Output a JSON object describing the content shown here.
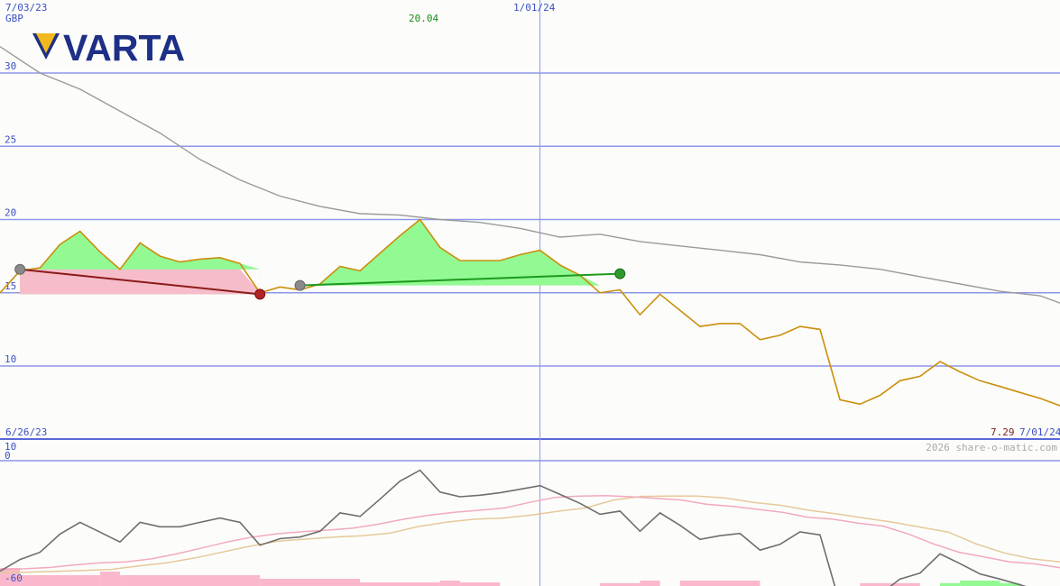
{
  "chart_data": [
    {
      "type": "line",
      "panel": "price",
      "currency": "GBP",
      "ylim": [
        5,
        33
      ],
      "y_ticks": [
        10,
        15,
        20,
        25,
        30
      ],
      "grid": true,
      "x_date_labels": {
        "start": "7/03/23",
        "mid": "1/01/24",
        "end": "7/01/24",
        "lower_start": "6/26/23"
      },
      "peak_label": "20.04",
      "last_value_label": "7.29",
      "watermark": "2026 share-o-matic.com",
      "series": [
        {
          "role": "price",
          "color": "#cc8e0c",
          "x": [
            "2023-06-26",
            "2023-07-03",
            "2023-07-10",
            "2023-07-17",
            "2023-07-24",
            "2023-07-31",
            "2023-08-07",
            "2023-08-14",
            "2023-08-21",
            "2023-08-28",
            "2023-09-04",
            "2023-09-11",
            "2023-09-18",
            "2023-09-25",
            "2023-10-02",
            "2023-10-09",
            "2023-10-16",
            "2023-10-23",
            "2023-10-30",
            "2023-11-06",
            "2023-11-13",
            "2023-11-20",
            "2023-11-27",
            "2023-12-04",
            "2023-12-11",
            "2023-12-18",
            "2023-12-25",
            "2024-01-01",
            "2024-01-08",
            "2024-01-15",
            "2024-01-22",
            "2024-01-29",
            "2024-02-05",
            "2024-02-12",
            "2024-02-19",
            "2024-02-26",
            "2024-03-04",
            "2024-03-11",
            "2024-03-18",
            "2024-03-25",
            "2024-04-01",
            "2024-04-08",
            "2024-04-15",
            "2024-04-22",
            "2024-04-29",
            "2024-05-06",
            "2024-05-13",
            "2024-05-20",
            "2024-05-27",
            "2024-06-03",
            "2024-06-10",
            "2024-06-17",
            "2024-06-24",
            "2024-07-01"
          ],
          "values": [
            15.0,
            16.5,
            16.7,
            18.3,
            19.2,
            17.8,
            16.6,
            18.4,
            17.5,
            17.1,
            17.3,
            17.4,
            17.0,
            15.0,
            15.4,
            15.2,
            15.6,
            16.8,
            16.5,
            17.7,
            18.9,
            20.0,
            18.1,
            17.2,
            17.2,
            17.2,
            17.6,
            17.9,
            16.9,
            16.2,
            15.0,
            15.2,
            13.5,
            14.9,
            13.8,
            12.7,
            12.9,
            12.9,
            11.8,
            12.1,
            12.7,
            12.5,
            7.7,
            7.4,
            8.0,
            9.0,
            9.3,
            10.3,
            9.6,
            9.0,
            8.6,
            8.2,
            7.8,
            7.29
          ]
        },
        {
          "role": "moving-average",
          "color": "#9a9a9a",
          "x": [
            "2023-06-26",
            "2023-07-10",
            "2023-07-24",
            "2023-08-07",
            "2023-08-21",
            "2023-09-04",
            "2023-09-18",
            "2023-10-02",
            "2023-10-16",
            "2023-10-30",
            "2023-11-13",
            "2023-11-27",
            "2023-12-11",
            "2023-12-25",
            "2024-01-08",
            "2024-01-22",
            "2024-02-05",
            "2024-02-19",
            "2024-03-04",
            "2024-03-18",
            "2024-04-01",
            "2024-04-15",
            "2024-04-29",
            "2024-05-13",
            "2024-05-27",
            "2024-06-10",
            "2024-06-24",
            "2024-07-01"
          ],
          "values": [
            31.8,
            30.0,
            28.9,
            27.4,
            25.9,
            24.1,
            22.7,
            21.6,
            20.9,
            20.4,
            20.3,
            20.0,
            19.8,
            19.4,
            18.8,
            19.0,
            18.5,
            18.2,
            17.9,
            17.6,
            17.1,
            16.9,
            16.6,
            16.1,
            15.6,
            15.1,
            14.8,
            14.3
          ]
        }
      ],
      "trades": [
        {
          "from": {
            "x": "2023-07-03",
            "y": 16.6
          },
          "to": {
            "x": "2023-09-25",
            "y": 14.9
          },
          "result": "loss",
          "color": "#8b1a1a"
        },
        {
          "from": {
            "x": "2023-10-09",
            "y": 15.5
          },
          "to": {
            "x": "2024-01-29",
            "y": 16.3
          },
          "result": "gain",
          "color": "#1e9a1e"
        }
      ]
    },
    {
      "type": "line",
      "panel": "indicator",
      "ylim": [
        -60,
        10
      ],
      "y_tick_labels": [
        "10",
        "0",
        "-60"
      ],
      "series": [
        {
          "role": "oscillator",
          "color": "#6e6e6e",
          "values": [
            -55.7,
            -49.8,
            -46.2,
            -37.0,
            -31.1,
            -36.0,
            -41.0,
            -31.1,
            -33.3,
            -33.3,
            -31.1,
            -28.9,
            -31.1,
            -42.6,
            -39.3,
            -38.5,
            -35.6,
            -26.3,
            -28.1,
            -19.4,
            -10.3,
            -4.8,
            -15.8,
            -18.2,
            -17.4,
            -16.2,
            -14.4,
            -12.6,
            -17.0,
            -21.5,
            -27.0,
            -25.4,
            -35.6,
            -26.3,
            -32.6,
            -39.7,
            -37.8,
            -36.7,
            -45.1,
            -42.2,
            -35.9,
            -37.4,
            -72.2,
            -73.3,
            -67.4,
            -59.7,
            -56.7,
            -47.0,
            -51.9,
            -57.1,
            -59.7,
            -62.6,
            -65.5,
            -70.0
          ]
        },
        {
          "role": "average-1",
          "color": "#f2a9c0",
          "values": [
            -55.0,
            -54.5,
            -53.8,
            -52.5,
            -51.5,
            -51.0,
            -49.5,
            -47.0,
            -44.0,
            -41.0,
            -38.5,
            -36.8,
            -35.8,
            -35.0,
            -34.0,
            -32.0,
            -29.5,
            -27.5,
            -26.0,
            -25.0,
            -23.8,
            -21.0,
            -18.5,
            -17.8,
            -17.6,
            -18.2,
            -19.0,
            -19.8,
            -22.0,
            -23.0,
            -24.5,
            -26.0,
            -28.5,
            -29.5,
            -31.5,
            -33.0,
            -37.0,
            -42.0,
            -46.2,
            -48.5,
            -51.0,
            -52.0,
            -54.0
          ]
        },
        {
          "role": "average-2",
          "color": "#e6c89a",
          "values": [
            -56.5,
            -56.2,
            -55.8,
            -55.3,
            -54.8,
            -53.0,
            -51.5,
            -49.0,
            -46.0,
            -43.0,
            -40.5,
            -39.5,
            -38.5,
            -37.8,
            -36.5,
            -33.2,
            -31.0,
            -29.5,
            -29.0,
            -27.5,
            -25.5,
            -23.8,
            -19.8,
            -18.0,
            -17.8,
            -17.8,
            -18.8,
            -21.0,
            -22.5,
            -25.0,
            -26.8,
            -29.0,
            -31.0,
            -33.5,
            -36.0,
            -42.0,
            -46.5,
            -49.5,
            -51.0
          ]
        }
      ],
      "histogram": [
        {
          "from": "2023-06-26",
          "to": "2023-07-03",
          "value": -5,
          "sign": "negative"
        },
        {
          "from": "2023-07-03",
          "to": "2023-07-31",
          "value": -3,
          "sign": "negative"
        },
        {
          "from": "2023-07-31",
          "to": "2023-08-07",
          "value": -4,
          "sign": "negative"
        },
        {
          "from": "2023-08-07",
          "to": "2023-09-25",
          "value": -3,
          "sign": "negative"
        },
        {
          "from": "2023-09-25",
          "to": "2023-10-30",
          "value": -2,
          "sign": "negative"
        },
        {
          "from": "2023-10-30",
          "to": "2023-11-27",
          "value": -1,
          "sign": "negative"
        },
        {
          "from": "2023-11-27",
          "to": "2023-12-04",
          "value": -1.5,
          "sign": "negative"
        },
        {
          "from": "2023-12-04",
          "to": "2023-12-18",
          "value": -1,
          "sign": "negative"
        },
        {
          "from": "2024-01-22",
          "to": "2024-02-05",
          "value": -0.8,
          "sign": "negative"
        },
        {
          "from": "2024-02-05",
          "to": "2024-02-12",
          "value": -1.5,
          "sign": "negative"
        },
        {
          "from": "2024-02-19",
          "to": "2024-03-18",
          "value": -1.5,
          "sign": "negative"
        },
        {
          "from": "2024-04-22",
          "to": "2024-05-13",
          "value": -0.8,
          "sign": "negative"
        },
        {
          "from": "2024-05-20",
          "to": "2024-05-27",
          "value": 0.8,
          "sign": "positive"
        },
        {
          "from": "2024-05-27",
          "to": "2024-06-10",
          "value": 1.5,
          "sign": "positive"
        },
        {
          "from": "2024-06-10",
          "to": "2024-06-17",
          "value": 0.8,
          "sign": "positive"
        }
      ]
    }
  ],
  "logo": {
    "text": "VARTA",
    "color": "#1d2f86",
    "accent": "#f3b81b"
  },
  "colors": {
    "grid": "#8e97e8",
    "ticks": "#3b4fc4",
    "gain_fill": "#93f993",
    "loss_fill": "#fbb8cc",
    "peak_label": "#1e8a1e",
    "last_label": "#7a1a1a"
  }
}
